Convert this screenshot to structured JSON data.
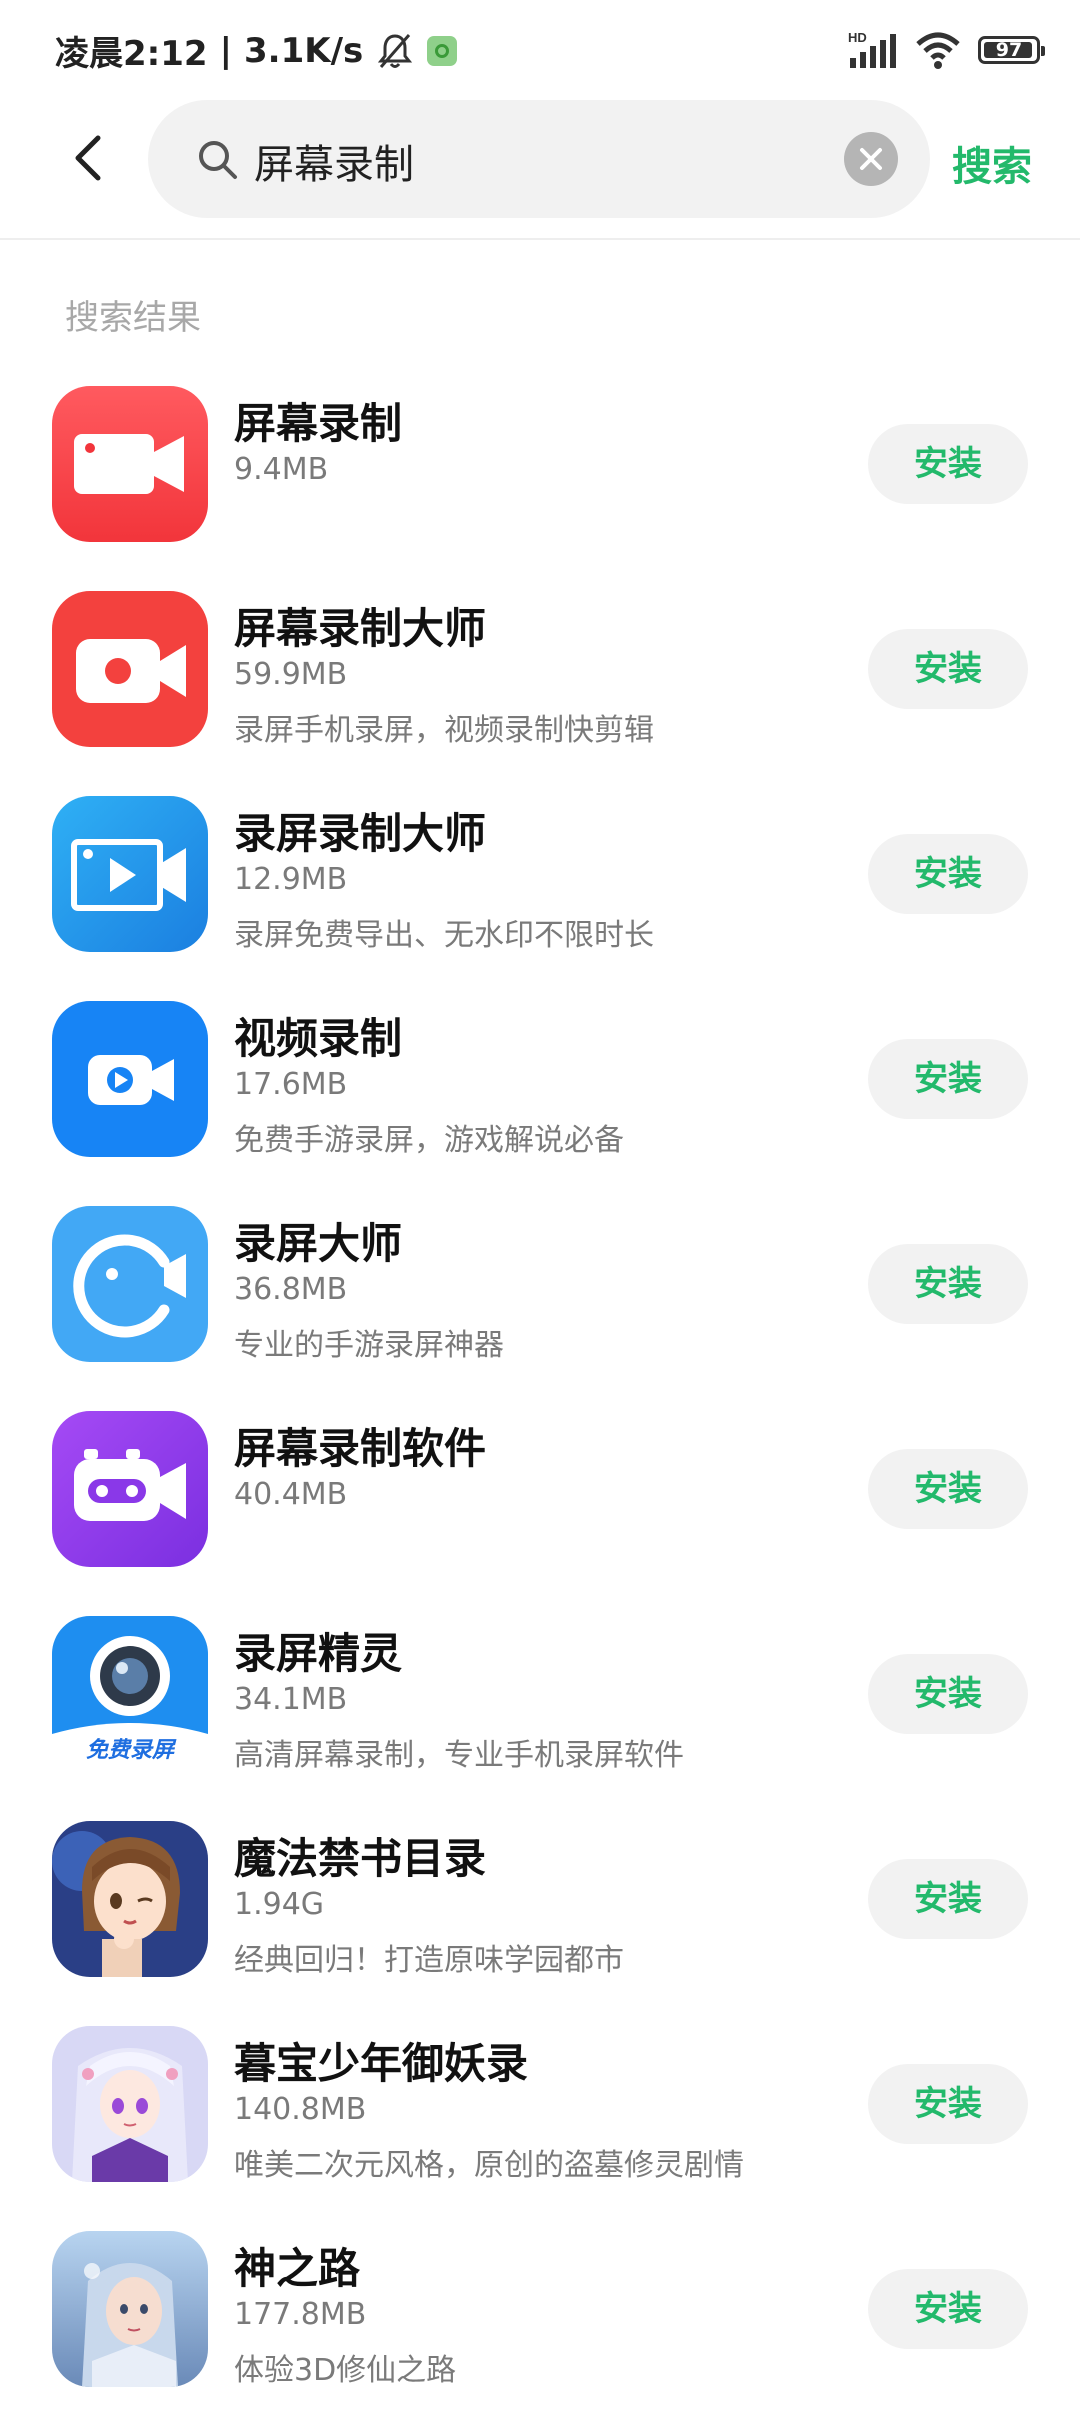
{
  "status_bar": {
    "time": "凌晨2:12",
    "speed": "3.1K/s",
    "network": "HD",
    "battery": "97"
  },
  "search": {
    "query": "屏幕录制",
    "search_button": "搜索"
  },
  "section_title": "搜索结果",
  "install_label": "安装",
  "results": [
    {
      "name": "屏幕录制",
      "size": "9.4MB",
      "desc": "",
      "icon": "video-camera-icon"
    },
    {
      "name": "屏幕录制大师",
      "size": "59.9MB",
      "desc": "录屏手机录屏，视频录制快剪辑",
      "icon": "record-camera-icon"
    },
    {
      "name": "录屏录制大师",
      "size": "12.9MB",
      "desc": "录屏免费导出、无水印不限时长",
      "icon": "play-camera-icon"
    },
    {
      "name": "视频录制",
      "size": "17.6MB",
      "desc": "免费手游录屏，游戏解说必备",
      "icon": "video-play-icon"
    },
    {
      "name": "录屏大师",
      "size": "36.8MB",
      "desc": "专业的手游录屏神器",
      "icon": "circle-camera-icon"
    },
    {
      "name": "屏幕录制软件",
      "size": "40.4MB",
      "desc": "",
      "icon": "robot-camera-icon"
    },
    {
      "name": "录屏精灵",
      "size": "34.1MB",
      "desc": "高清屏幕录制，专业手机录屏软件",
      "icon": "lens-icon",
      "icon_caption": "免费录屏"
    },
    {
      "name": "魔法禁书目录",
      "size": "1.94G",
      "desc": "经典回归！打造原味学园都市",
      "icon": "anime-girl-icon"
    },
    {
      "name": "暮宝少年御妖录",
      "size": "140.8MB",
      "desc": "唯美二次元风格，原创的盗墓修灵剧情",
      "icon": "anime-fairy-icon"
    },
    {
      "name": "神之路",
      "size": "177.8MB",
      "desc": "体验3D修仙之路",
      "icon": "fantasy-heroine-icon"
    }
  ]
}
